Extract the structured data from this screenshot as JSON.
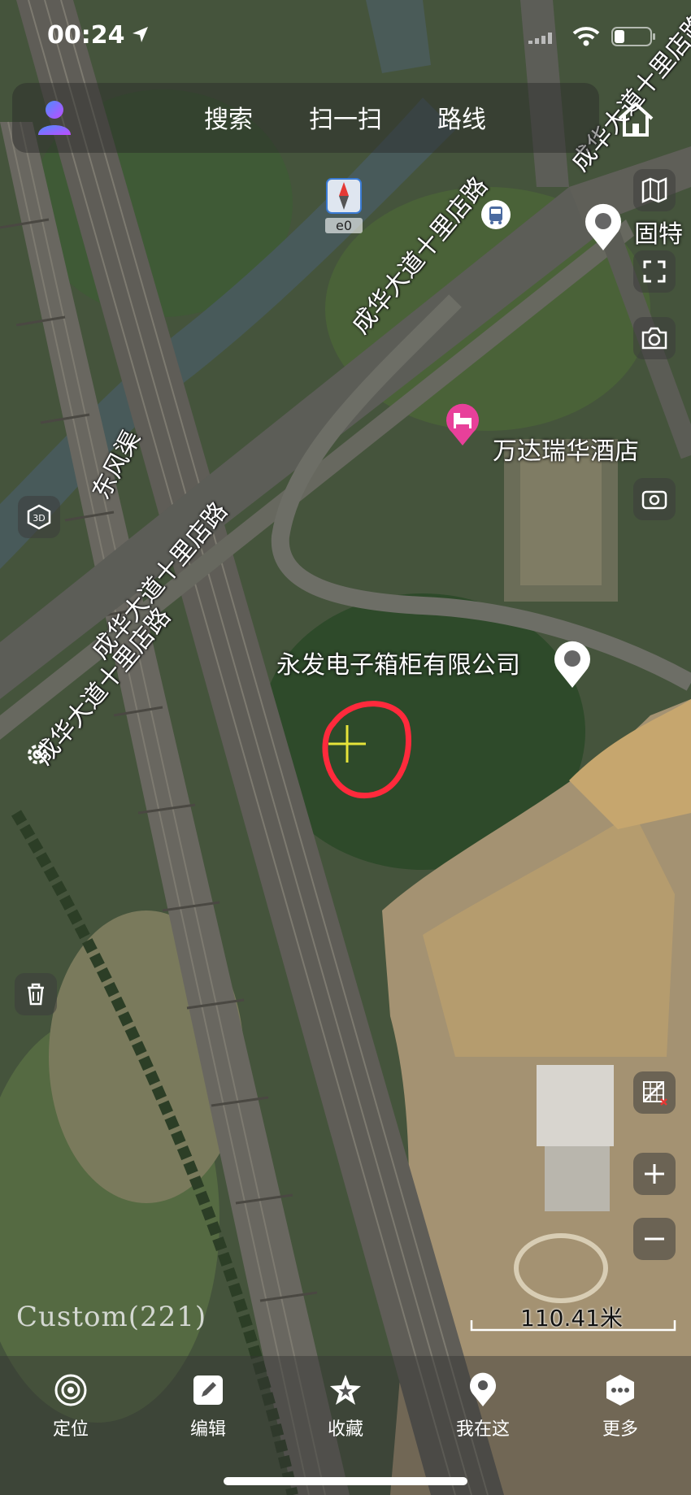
{
  "status_bar": {
    "time": "00:24"
  },
  "top_bar": {
    "search_label": "搜索",
    "scan_label": "扫一扫",
    "route_label": "路线"
  },
  "compass": {
    "label": "e0"
  },
  "map_labels": {
    "road_1": "成华大道十里店路",
    "road_2": "成华大道十里店路",
    "road_3": "成华大道十里店路",
    "road_4": "成华大道十里店路",
    "canal": "东风渠",
    "poi_hotel": "万达瑞华酒店",
    "poi_company": "永发电子箱柜有限公司",
    "poi_partial": "固特"
  },
  "overlay": {
    "custom_label": "Custom(221)",
    "scale_label": "110.41米"
  },
  "bottom_bar": {
    "locate_label": "定位",
    "edit_label": "编辑",
    "favorite_label": "收藏",
    "here_label": "我在这",
    "more_label": "更多"
  },
  "colors": {
    "accent_user": "#7a5cff",
    "poi_pink": "#e8409a",
    "marker_red": "#ff2a3c",
    "crosshair_yellow": "#e6e43a"
  }
}
